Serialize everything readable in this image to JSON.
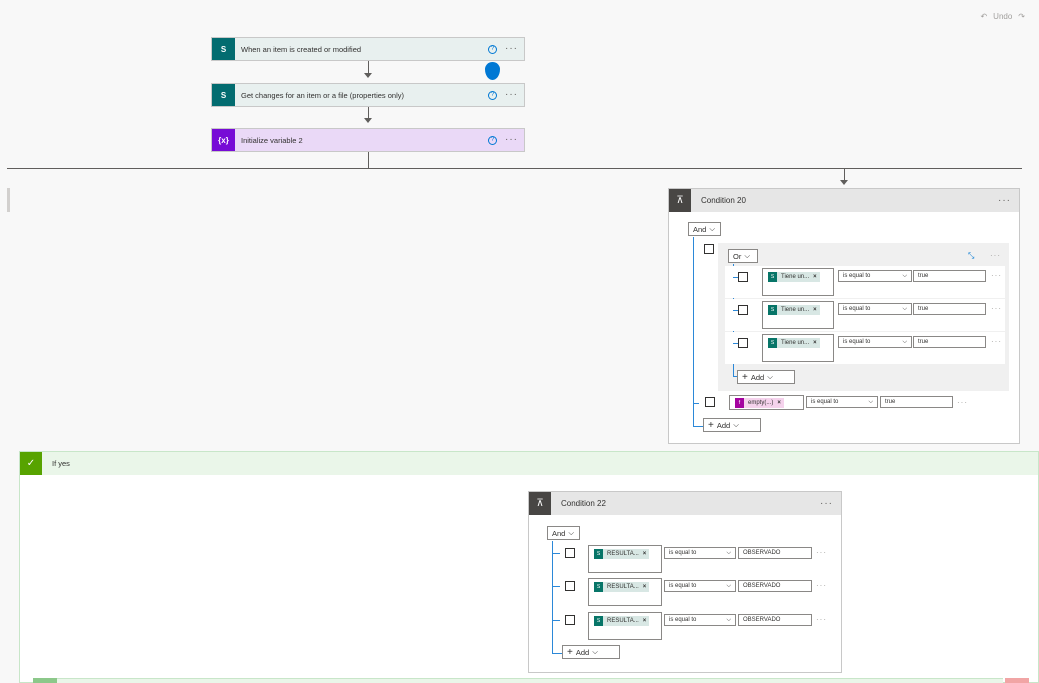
{
  "toolbar": {
    "undo_label": "Undo",
    "undo_icon": "undo-icon",
    "redo_icon": "redo-icon"
  },
  "flow": {
    "step1": {
      "title": "When an item is created or modified",
      "icon": "sharepoint-icon",
      "color": "#036c70"
    },
    "step2": {
      "title": "Get changes for an item or a file (properties only)",
      "icon": "sharepoint-icon",
      "color": "#036c70"
    },
    "step3": {
      "title": "Initialize variable 2",
      "icon": "variable-icon",
      "icon_text": "{x}",
      "color": "#770bd6"
    }
  },
  "condition20": {
    "title": "Condition 20",
    "and_label": "And",
    "or_label": "Or",
    "rows": [
      {
        "token": "Tiene un...",
        "operator": "is equal to",
        "value": "true"
      },
      {
        "token": "Tiene un...",
        "operator": "is equal to",
        "value": "true"
      },
      {
        "token": "Tiene un...",
        "operator": "is equal to",
        "value": "true"
      }
    ],
    "add_label": "Add",
    "outer_row": {
      "token": "empty(...)",
      "operator": "is equal to",
      "value": "true"
    },
    "outer_add_label": "Add"
  },
  "ifyes": {
    "label": "If yes"
  },
  "condition22": {
    "title": "Condition 22",
    "and_label": "And",
    "rows": [
      {
        "token": "RESULTA...",
        "operator": "is equal to",
        "value": "OBSERVADO"
      },
      {
        "token": "RESULTA...",
        "operator": "is equal to",
        "value": "OBSERVADO"
      },
      {
        "token": "RESULTA...",
        "operator": "is equal to",
        "value": "OBSERVADO"
      }
    ],
    "add_label": "Add"
  }
}
